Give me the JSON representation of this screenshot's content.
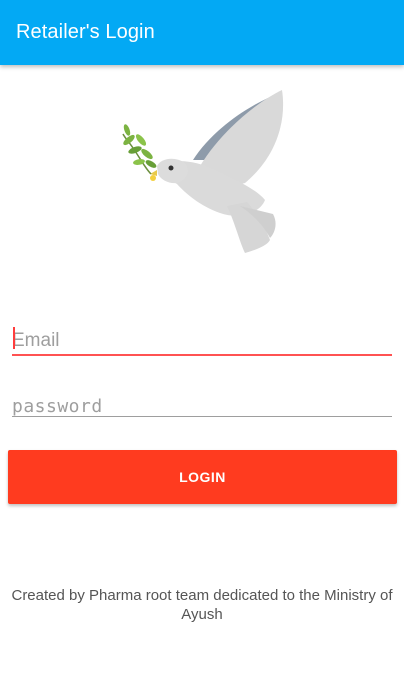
{
  "app_bar": {
    "title": "Retailer's Login",
    "background_color": "#03A9F4"
  },
  "logo": {
    "icon": "dove-with-olive-branch-icon"
  },
  "form": {
    "email": {
      "placeholder": "Email",
      "value": "",
      "underline_color": "#FF5252"
    },
    "password": {
      "placeholder": "password",
      "value": ""
    },
    "login_button": {
      "label": "LOGIN",
      "color": "#FF3B1F"
    }
  },
  "footer": {
    "text": "Created by Pharma root team dedicated to the Ministry of Ayush"
  }
}
